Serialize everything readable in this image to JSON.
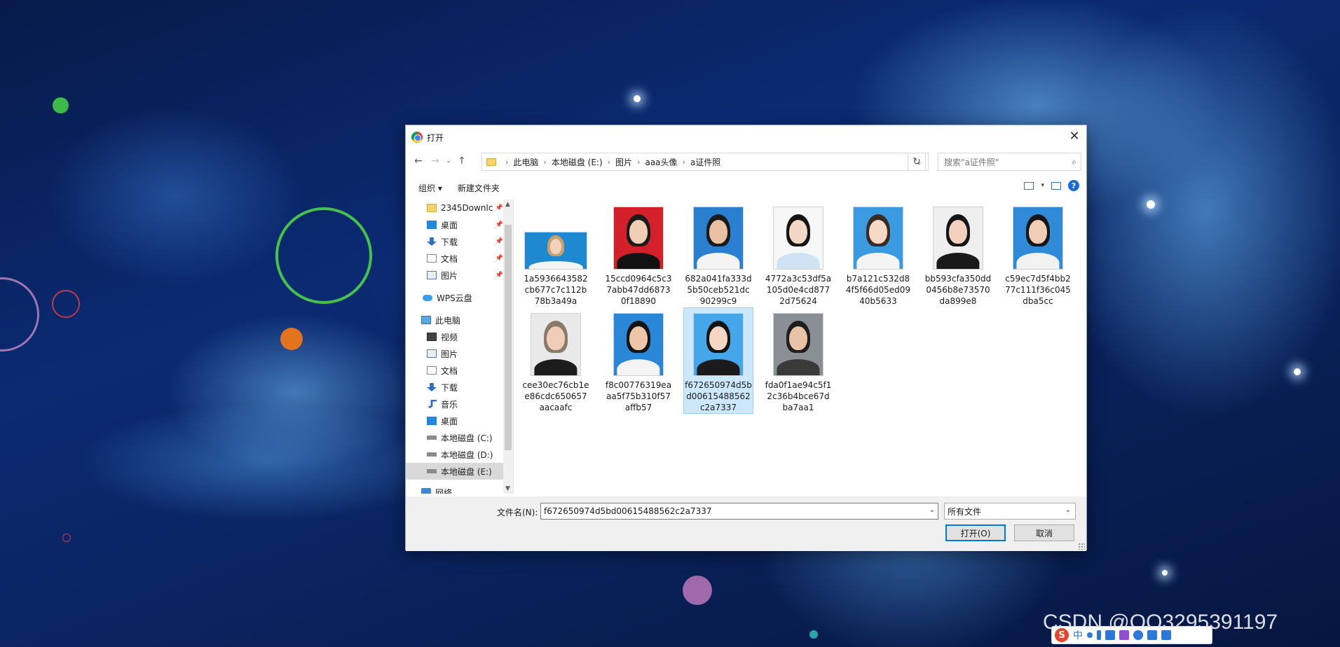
{
  "dialog": {
    "title": "打开",
    "close_symbol": "✕"
  },
  "address": {
    "breadcrumbs": [
      "此电脑",
      "本地磁盘 (E:)",
      "图片",
      "aaa头像",
      "a证件照"
    ],
    "separator": "›",
    "search_placeholder": "搜索\"a证件照\""
  },
  "toolbar": {
    "organize_label": "组织 ▾",
    "new_folder_label": "新建文件夹",
    "help_symbol": "?"
  },
  "sidebar": {
    "items": [
      {
        "label": "2345Downlc",
        "icon": "folder-icon",
        "pinned": true
      },
      {
        "label": "桌面",
        "icon": "desktop-icon",
        "pinned": true
      },
      {
        "label": "下载",
        "icon": "download-icon",
        "pinned": true
      },
      {
        "label": "文档",
        "icon": "document-icon",
        "pinned": true
      },
      {
        "label": "图片",
        "icon": "picture-icon",
        "pinned": true
      },
      {
        "label": "WPS云盘",
        "icon": "cloud-icon",
        "pinned": false
      },
      {
        "label": "此电脑",
        "icon": "computer-icon",
        "pinned": false
      },
      {
        "label": "视频",
        "icon": "video-icon",
        "pinned": false
      },
      {
        "label": "图片",
        "icon": "picture-icon",
        "pinned": false
      },
      {
        "label": "文档",
        "icon": "document-icon",
        "pinned": false
      },
      {
        "label": "下载",
        "icon": "download-icon",
        "pinned": false
      },
      {
        "label": "音乐",
        "icon": "music-icon",
        "pinned": false
      },
      {
        "label": "桌面",
        "icon": "desktop-icon",
        "pinned": false
      },
      {
        "label": "本地磁盘 (C:)",
        "icon": "drive-icon",
        "pinned": false
      },
      {
        "label": "本地磁盘 (D:)",
        "icon": "drive-icon",
        "pinned": false
      },
      {
        "label": "本地磁盘 (E:)",
        "icon": "drive-icon",
        "pinned": false,
        "selected": true
      },
      {
        "label": "网络",
        "icon": "network-icon",
        "pinned": false
      }
    ]
  },
  "files": [
    {
      "name": "1a5936643582cb677c7c112b78b3a49a",
      "bg": "#1e88d0",
      "skin": "#f3d2bd",
      "hair": "#c9a06a",
      "cloth": "#f4f4f4",
      "landscape": true
    },
    {
      "name": "15ccd0964c5c37abb47dd68730f18890",
      "bg": "#d3202a",
      "skin": "#f1cdb5",
      "hair": "#1b1b1b",
      "cloth": "#121212"
    },
    {
      "name": "682a041fa333d5b50ceb521dc90299c9",
      "bg": "#2a7fd0",
      "skin": "#e9c0a2",
      "hair": "#1a1a1a",
      "cloth": "#f4f4f4"
    },
    {
      "name": "4772a3c53df5a105d0e4cd8772d75624",
      "bg": "#f7f7f7",
      "skin": "#f4d6c5",
      "hair": "#141414",
      "cloth": "#cfe3f5"
    },
    {
      "name": "b7a121c532d84f5f66d05ed0940b5633",
      "bg": "#3a9be0",
      "skin": "#f5d8c6",
      "hair": "#3a2a22",
      "cloth": "#f4f4f4"
    },
    {
      "name": "bb593cfa350dd0456b8e73570da899e8",
      "bg": "#efefef",
      "skin": "#f2d0bd",
      "hair": "#161616",
      "cloth": "#1a1a1a"
    },
    {
      "name": "c59ec7d5f4bb277c111f36c045dba5cc",
      "bg": "#2f8ad8",
      "skin": "#efcdb6",
      "hair": "#161616",
      "cloth": "#f2f2f2"
    },
    {
      "name": "cee30ec76cb1ee86cdc650657aacaafc",
      "bg": "#e9e9e9",
      "skin": "#efcdb8",
      "hair": "#8a7a6a",
      "cloth": "#1c1c1c"
    },
    {
      "name": "f8c00776319eaaa5f75b310f57affb57",
      "bg": "#2a86d6",
      "skin": "#ecc6a8",
      "hair": "#141414",
      "cloth": "#f4f4f4"
    },
    {
      "name": "f672650974d5bd00615488562c2a7337",
      "bg": "#46a6ea",
      "skin": "#f4d6c5",
      "hair": "#141414",
      "cloth": "#1b1b1b",
      "selected": true
    },
    {
      "name": "fda0f1ae94c5f12c36b4bce67dba7aa1",
      "bg": "#8a8f96",
      "skin": "#e8c3a6",
      "hair": "#1e1e1e",
      "cloth": "#3a3a3a"
    }
  ],
  "bottom": {
    "filename_label": "文件名(N):",
    "filename_value": "f672650974d5bd00615488562c2a7337",
    "filetype_value": "所有文件",
    "open_label": "打开(O)",
    "cancel_label": "取消"
  },
  "watermark": "CSDN @QQ3295391197",
  "ime": {
    "logo": "S",
    "lang": "中"
  },
  "colors": {
    "accent": "#0078d7",
    "selection_fill": "#cce8ff",
    "selection_border": "#99d1ff"
  }
}
